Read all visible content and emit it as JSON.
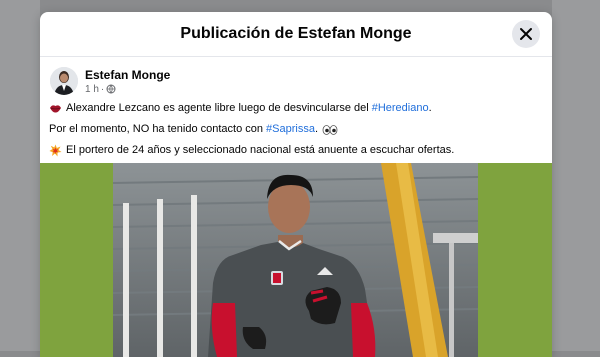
{
  "modal": {
    "title": "Publicación de Estefan Monge",
    "close_icon": "close-icon"
  },
  "post": {
    "author": "Estefan Monge",
    "time": "1 h",
    "separator": "·",
    "audience_icon": "globe-icon",
    "lines": [
      {
        "icon": "lips-emoji",
        "text": "Alexandre Lezcano es agente libre luego de desvincularse del",
        "hashtag": "#Herediano",
        "suffix": "."
      },
      {
        "icon": "",
        "text": "Por el momento, NO ha tenido contacto con",
        "hashtag": "#Saprissa",
        "suffix": ".",
        "trailing_icon": "eyes-emoji"
      },
      {
        "icon": "boom-emoji",
        "text": "El portero de 24 años y seleccionado nacional está anuente a escuchar ofertas.",
        "hashtag": "",
        "suffix": ""
      }
    ]
  },
  "colors": {
    "hashtag": "#216fdb",
    "media_background": "#7fa33e",
    "jersey": "#4a4f52",
    "sleeves": "#c8102e"
  }
}
